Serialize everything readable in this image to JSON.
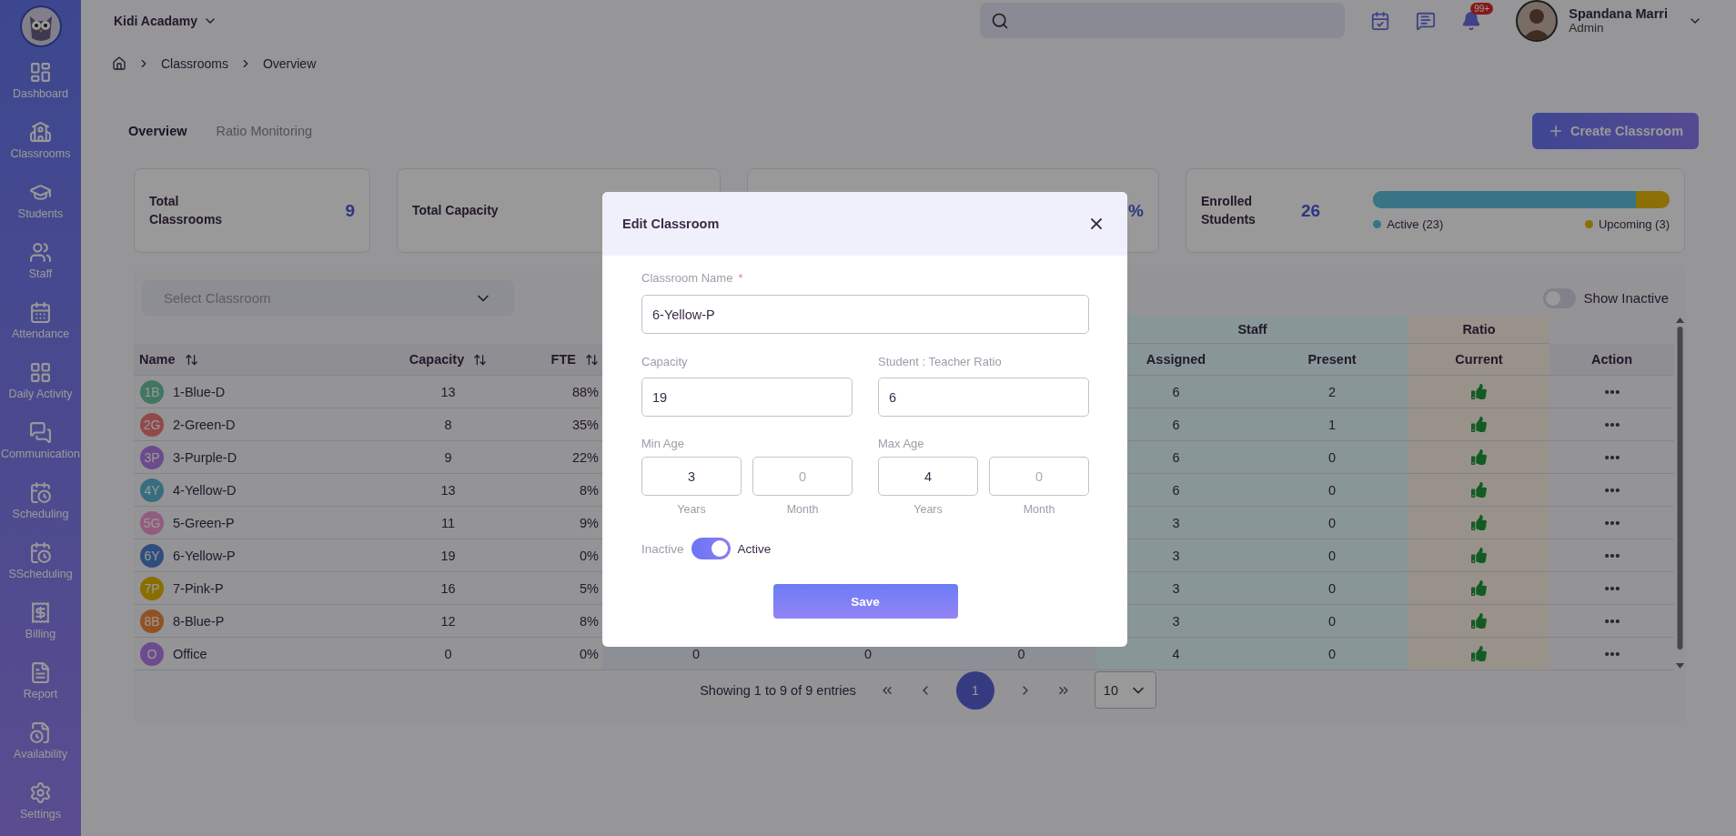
{
  "sidebar": {
    "items": [
      {
        "label": "Dashboard"
      },
      {
        "label": "Classrooms"
      },
      {
        "label": "Students"
      },
      {
        "label": "Staff"
      },
      {
        "label": "Attendance"
      },
      {
        "label": "Daily Activity"
      },
      {
        "label": "Communication"
      },
      {
        "label": "Scheduling"
      },
      {
        "label": "SScheduling"
      },
      {
        "label": "Billing"
      },
      {
        "label": "Report"
      },
      {
        "label": "Availability"
      },
      {
        "label": "Settings"
      }
    ]
  },
  "topbar": {
    "school": "Kidi Acadamy",
    "notification_badge": "99+",
    "user": {
      "name": "Spandana Marri",
      "role": "Admin"
    }
  },
  "breadcrumb": [
    "Classrooms",
    "Overview"
  ],
  "tabs": [
    {
      "label": "Overview",
      "selected": true
    },
    {
      "label": "Ratio Monitoring",
      "selected": false
    }
  ],
  "create_button": "Create Classroom",
  "stats": [
    {
      "kind": "count",
      "label": "Total Classrooms",
      "value": "9"
    },
    {
      "kind": "count",
      "label": "Total Capacity"
    },
    {
      "kind": "count",
      "value": "%"
    },
    {
      "kind": "enrollment",
      "label": "Enrolled Students",
      "value": "26",
      "level": 0.885,
      "legend": [
        {
          "label": "Active (23)",
          "color": "#377586"
        },
        {
          "label": "Upcoming (3)",
          "color": "#8b6f07"
        }
      ]
    }
  ],
  "filter": {
    "placeholder": "Select Classroom"
  },
  "show_inactive": {
    "label": "Show Inactive",
    "on": false
  },
  "table": {
    "groups": [
      "Staff",
      "Ratio"
    ],
    "columns": [
      {
        "label": "Name",
        "sortable": true
      },
      {
        "label": "Capacity",
        "sortable": true
      },
      {
        "label": "FTE",
        "sortable": true
      },
      {
        "label": "Assigned",
        "sortable": false
      },
      {
        "label": "Present",
        "sortable": false
      },
      {
        "label": "Current",
        "sortable": false
      },
      {
        "label": "Action",
        "sortable": false
      }
    ],
    "rows": [
      {
        "initials": "1B",
        "color": "#417662",
        "name": "1-Blue-D",
        "capacity": "13",
        "fte": "88%",
        "assigned": "6",
        "present": "2",
        "ratio_ok": true
      },
      {
        "initials": "2G",
        "color": "#904a4a",
        "name": "2-Green-D",
        "capacity": "8",
        "fte": "35%",
        "assigned": "6",
        "present": "1",
        "ratio_ok": true
      },
      {
        "initials": "3P",
        "color": "#6c4b8a",
        "name": "3-Purple-D",
        "capacity": "9",
        "fte": "22%",
        "assigned": "6",
        "present": "0",
        "ratio_ok": true
      },
      {
        "initials": "4Y",
        "color": "#386d7f",
        "name": "4-Yellow-D",
        "capacity": "13",
        "fte": "8%",
        "assigned": "6",
        "present": "0",
        "ratio_ok": true
      },
      {
        "initials": "5G",
        "color": "#915d7e",
        "name": "5-Green-P",
        "capacity": "11",
        "fte": "9%",
        "assigned": "3",
        "present": "0",
        "ratio_ok": true
      },
      {
        "initials": "6Y",
        "color": "#304e7c",
        "name": "6-Yellow-P",
        "capacity": "19",
        "fte": "0%",
        "assigned": "3",
        "present": "0",
        "ratio_ok": true
      },
      {
        "initials": "7P",
        "color": "#8a6e00",
        "name": "7-Pink-P",
        "capacity": "16",
        "fte": "5%",
        "assigned": "3",
        "present": "0",
        "ratio_ok": true
      },
      {
        "initials": "8B",
        "color": "#915223",
        "name": "8-Blue-P",
        "capacity": "12",
        "fte": "8%",
        "assigned": "3",
        "present": "0",
        "ratio_ok": true
      },
      {
        "initials": "O",
        "color": "#6d4c8e",
        "name": "Office",
        "capacity": "0",
        "fte": "0%",
        "column_4": "0",
        "column_5": "0",
        "column_6": "0",
        "assigned": "4",
        "present": "0",
        "ratio_ok": true
      }
    ]
  },
  "pagination": {
    "summary": "Showing 1 to 9 of 9 entries",
    "pages": [
      {
        "label": "1",
        "selected": true
      }
    ],
    "page_size": "10"
  },
  "modal": {
    "title": "Edit Classroom",
    "name_field": {
      "label": "Classroom Name",
      "required_mark": "*",
      "value": "6-Yellow-P"
    },
    "capacity_field": {
      "label": "Capacity",
      "value": "19"
    },
    "ratio_field": {
      "label": "Student : Teacher Ratio",
      "value": "6"
    },
    "age_ranges": [
      {
        "label": "Min Age",
        "parts": [
          {
            "value": "3",
            "caption": "Years"
          },
          {
            "placeholder": "0",
            "caption": "Month"
          }
        ]
      },
      {
        "label": "Max Age",
        "parts": [
          {
            "value": "4",
            "caption": "Years"
          },
          {
            "placeholder": "0",
            "caption": "Month"
          }
        ]
      }
    ],
    "status": {
      "off_label": "Inactive",
      "on_label": "Active",
      "on": true
    },
    "save": "Save"
  }
}
